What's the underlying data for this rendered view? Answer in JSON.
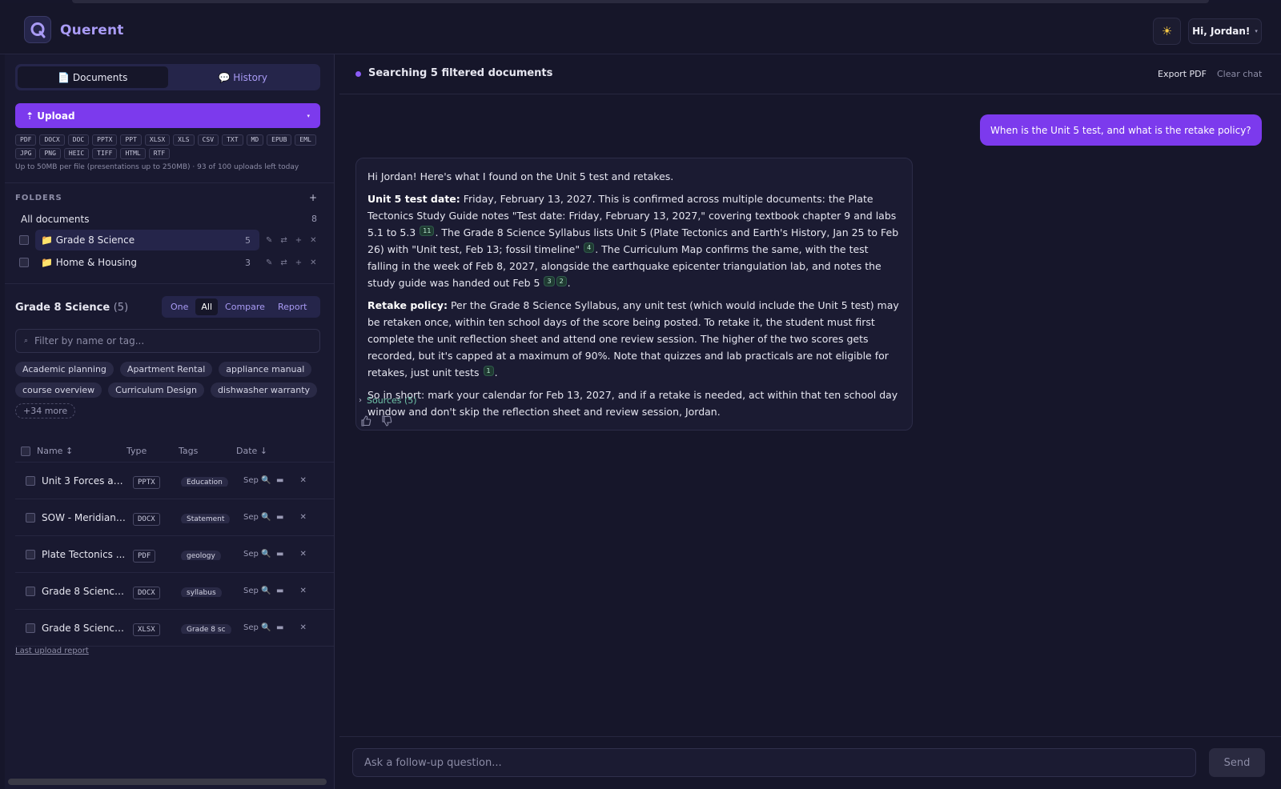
{
  "app": {
    "brand": "Querent",
    "theme_icon": "sun-icon",
    "greeting": "Hi, Jordan!"
  },
  "sidebar": {
    "tabs": [
      {
        "label": "📄 Documents",
        "active": true
      },
      {
        "label": "💬 History",
        "active": false
      }
    ],
    "upload_label": "⇡ Upload",
    "formats": [
      "PDF",
      "DOCX",
      "DOC",
      "PPTX",
      "PPT",
      "XLSX",
      "XLS",
      "CSV",
      "TXT",
      "MD",
      "EPUB",
      "EML",
      "JPG",
      "PNG",
      "HEIC",
      "TIFF",
      "HTML",
      "RTF"
    ],
    "limits": "Up to 50MB per file (presentations up to 250MB) · 93 of 100 uploads left today",
    "folders_title": "FOLDERS",
    "folders_add": "+",
    "all_documents": {
      "label": "All documents",
      "count": "8"
    },
    "folders": [
      {
        "label": "📁 Grade 8 Science",
        "count": "5",
        "selected": true
      },
      {
        "label": "📁 Home & Housing",
        "count": "3",
        "selected": false
      }
    ],
    "folder_actions": [
      "✎",
      "⇄",
      "+",
      "✕"
    ],
    "collection": {
      "title": "Grade 8 Science",
      "count": "(5)"
    },
    "modes": [
      {
        "label": "One",
        "active": false
      },
      {
        "label": "All",
        "active": true
      },
      {
        "label": "Compare",
        "active": false
      },
      {
        "label": "Report",
        "active": false
      }
    ],
    "filter_placeholder": "Filter by name or tag...",
    "tags": [
      "Academic planning",
      "Apartment Rental",
      "appliance manual",
      "course overview",
      "Curriculum Design",
      "dishwasher warranty"
    ],
    "more_tags": "+34 more",
    "table": {
      "headers": {
        "name": "Name",
        "type": "Type",
        "tags": "Tags",
        "date": "Date"
      },
      "name_sort_icon": "↕",
      "date_sort_icon": "↓",
      "rows": [
        {
          "name": "Unit 3 Forces an...",
          "type": "PPTX",
          "tag": "Education",
          "date": "Sep"
        },
        {
          "name": "SOW - Meridian ...",
          "type": "DOCX",
          "tag": "Statement",
          "date": "Sep"
        },
        {
          "name": "Plate Tectonics ...",
          "type": "PDF",
          "tag": "geology",
          "date": "Sep"
        },
        {
          "name": "Grade 8 Science...",
          "type": "DOCX",
          "tag": "syllabus",
          "date": "Sep"
        },
        {
          "name": "Grade 8 Science...",
          "type": "XLSX",
          "tag": "Grade 8 sc",
          "date": "Sep"
        }
      ]
    },
    "last_upload_report": "Last upload report"
  },
  "main": {
    "status": "Searching 5 filtered documents",
    "export_pdf": "Export PDF",
    "clear_chat": "Clear chat",
    "user_message": "When is the Unit 5 test, and what is the retake policy?",
    "answer": {
      "intro": "Hi Jordan! Here's what I found on the Unit 5 test and retakes.",
      "p1_label": "Unit 5 test date:",
      "p1_a": " Friday, February 13, 2027. This is confirmed across multiple documents: the Plate Tectonics Study Guide notes \"Test date: Friday, February 13, 2027,\" covering textbook chapter 9 and labs 5.1 to 5.3",
      "p1_cite1": "11",
      "p1_b": ". The Grade 8 Science Syllabus lists Unit 5 (Plate Tectonics and Earth's History, Jan 25 to Feb 26) with \"Unit test, Feb 13; fossil timeline\"",
      "p1_cite2": "4",
      "p1_c": ". The Curriculum Map confirms the same, with the test falling in the week of Feb 8, 2027, alongside the earthquake epicenter triangulation lab, and notes the study guide was handed out Feb 5",
      "p1_cite3": "3",
      "p1_cite4": "2",
      "p1_d": ".",
      "p2_label": "Retake policy:",
      "p2_a": " Per the Grade 8 Science Syllabus, any unit test (which would include the Unit 5 test) may be retaken once, within ten school days of the score being posted. To retake it, the student must first complete the unit reflection sheet and attend one review session. The higher of the two scores gets recorded, but it's capped at a maximum of 90%. Note that quizzes and lab practicals are not eligible for retakes, just unit tests",
      "p2_cite1": "1",
      "p2_b": ".",
      "p3": "So in short: mark your calendar for Feb 13, 2027, and if a retake is needed, act within that ten school day window and don't skip the reflection sheet and review session, Jordan."
    },
    "sources_label": "Sources (5)",
    "composer_placeholder": "Ask a follow-up question...",
    "send_label": "Send"
  },
  "colors": {
    "accent": "#7c3aed",
    "background": "#16162a",
    "sidebar": "#191930",
    "brand": "#a99bf5",
    "citation": "#1f3a32"
  }
}
